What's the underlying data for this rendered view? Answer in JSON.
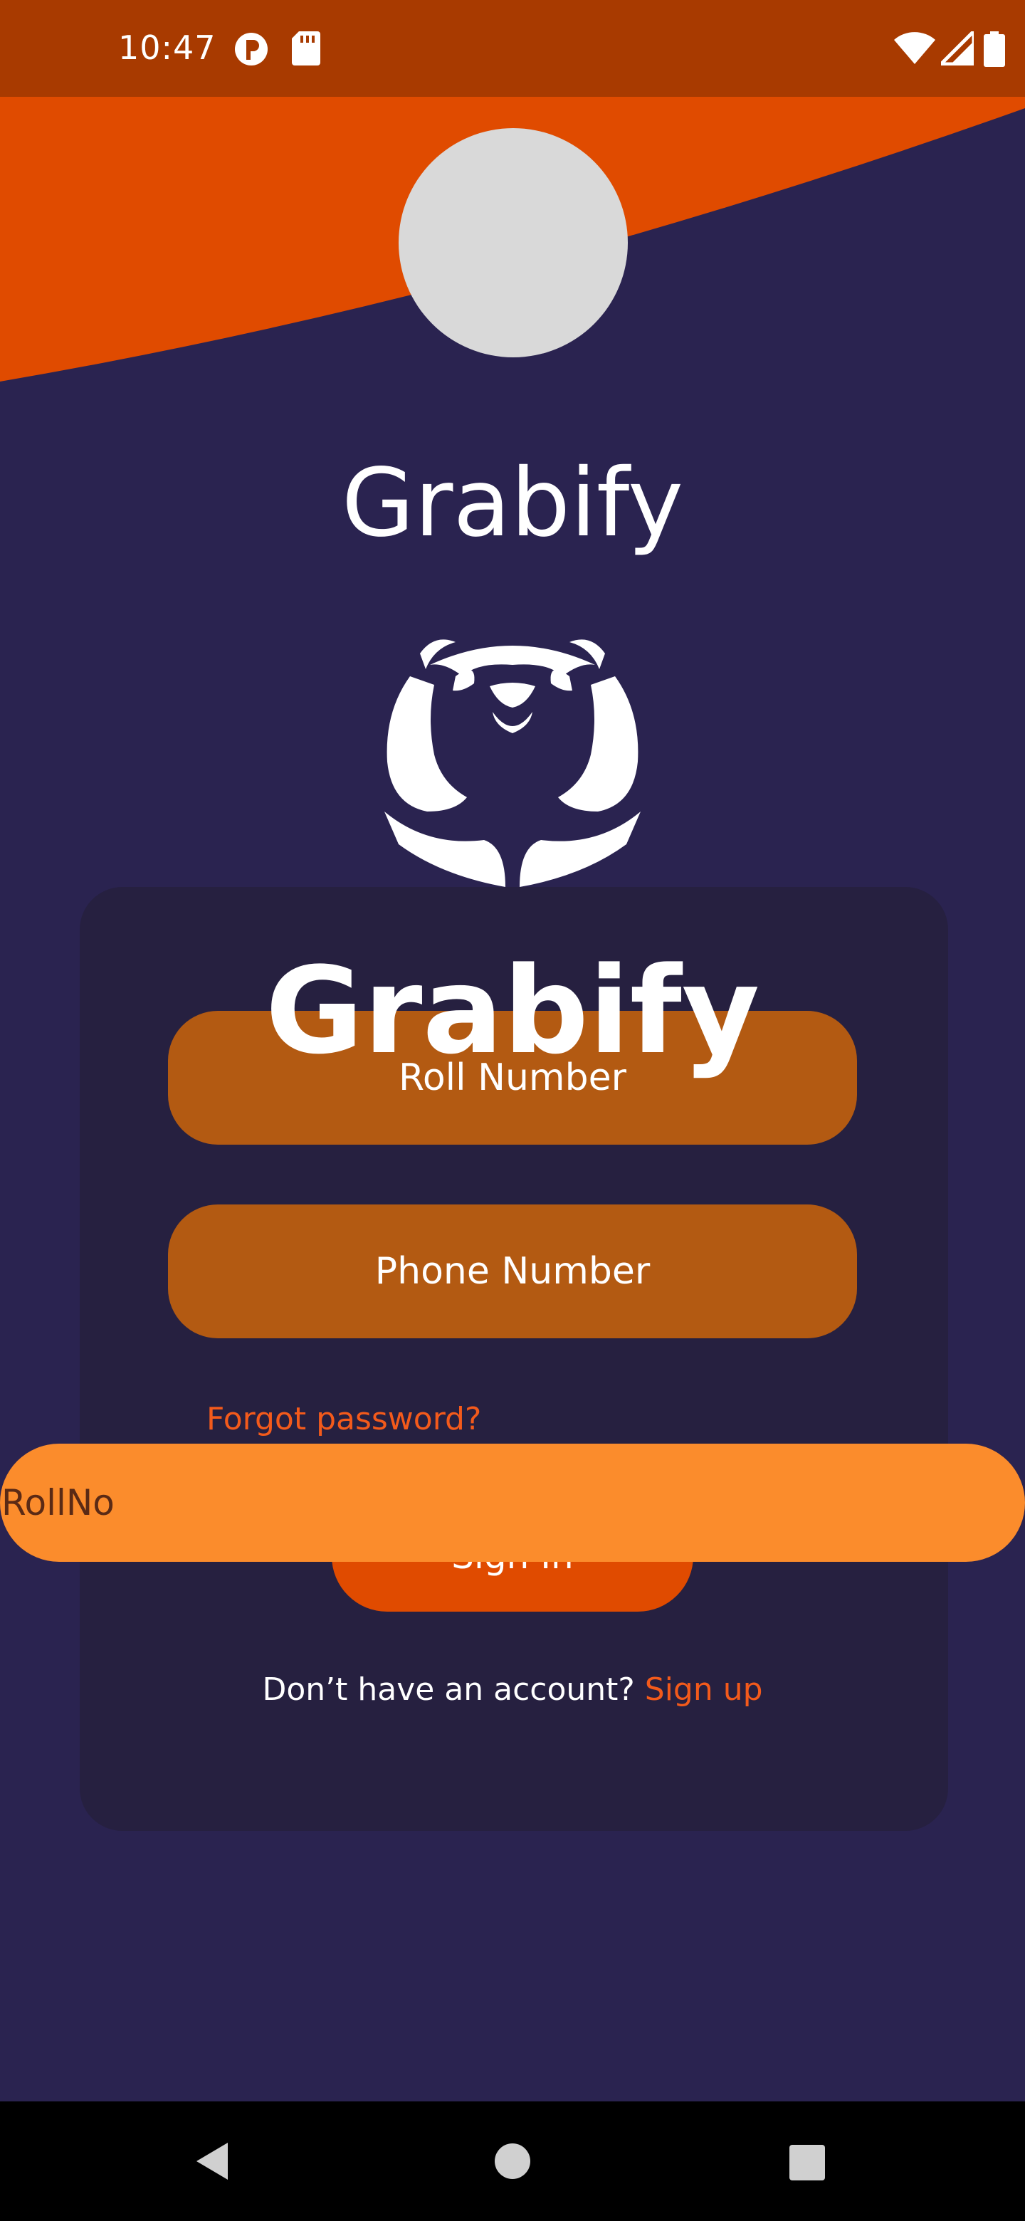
{
  "status_bar": {
    "time": "10:47",
    "icons": [
      "notification-app-icon",
      "sd-card-icon",
      "wifi-icon",
      "cell-signal-icon",
      "battery-icon"
    ]
  },
  "header": {
    "app_title": "Grabify"
  },
  "logo": {
    "emblem_icon": "panda-hands-logo-icon",
    "wordmark": "Grabify"
  },
  "form": {
    "roll_number_placeholder": "Roll Number",
    "phone_number_placeholder": "Phone Number",
    "forgot_password": "Forgot password?",
    "sign_in_label": "Sign In",
    "overlay_input_value": "RollNo",
    "signup_prompt": "Don’t have an account?",
    "signup_link": "Sign up"
  },
  "nav_bar": {
    "icons": [
      "back-icon",
      "home-icon",
      "recents-icon"
    ]
  },
  "colors": {
    "background": "#2a2350",
    "card": "#262040",
    "status_bar": "#a83a00",
    "header_orange": "#e04b00",
    "field": "#b35a12",
    "accent": "#f35a1b",
    "overlay_input": "#fb8c2c"
  }
}
